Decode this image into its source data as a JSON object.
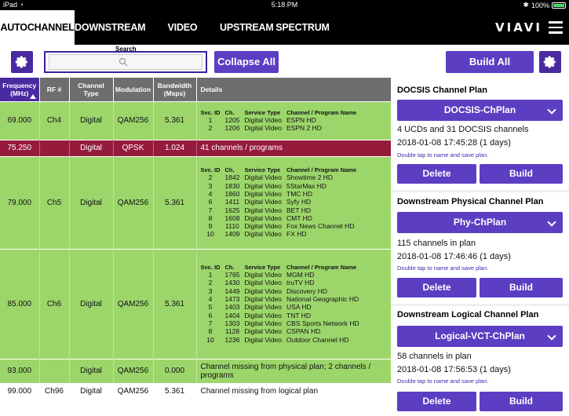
{
  "status_bar": {
    "device": "iPad",
    "time": "5:18 PM",
    "battery": "100%"
  },
  "tabs": [
    "AUTOCHANNEL",
    "DOWNSTREAM",
    "VIDEO ANALYZER",
    "UPSTREAM",
    "SPECTRUM"
  ],
  "brand": "VIAVI",
  "toolbar": {
    "search_label": "Search",
    "search_placeholder": "",
    "collapse_all": "Collapse All",
    "build_all": "Build All"
  },
  "table": {
    "headers": {
      "frequency": "Frequency (MHz)",
      "rf": "RF #",
      "channel_type": "Channel Type",
      "modulation": "Modulation",
      "bandwidth": "Bandwidth (Msps)",
      "details": "Details"
    },
    "svc_headers": {
      "svc_id": "Svc. ID",
      "ch": "Ch.",
      "service_type": "Service Type",
      "program": "Channel / Program Name"
    },
    "rows": [
      {
        "freq": "69.000",
        "rf": "Ch4",
        "type": "Digital",
        "mod": "QAM256",
        "bw": "5.361",
        "services": [
          {
            "id": "1",
            "ch": "1205",
            "stype": "Digital Video",
            "name": "ESPN HD"
          },
          {
            "id": "2",
            "ch": "1206",
            "stype": "Digital Video",
            "name": "ESPN 2 HD"
          }
        ]
      },
      {
        "freq": "75.250",
        "rf": "",
        "type": "Digital",
        "mod": "QPSK",
        "bw": "1.024",
        "note": "41 channels / programs"
      },
      {
        "freq": "79.000",
        "rf": "Ch5",
        "type": "Digital",
        "mod": "QAM256",
        "bw": "5.361",
        "services": [
          {
            "id": "2",
            "ch": "1842",
            "stype": "Digital Video",
            "name": "Showtime 2 HD"
          },
          {
            "id": "3",
            "ch": "1830",
            "stype": "Digital Video",
            "name": "5StarMax HD"
          },
          {
            "id": "4",
            "ch": "1860",
            "stype": "Digital Video",
            "name": "TMC HD"
          },
          {
            "id": "6",
            "ch": "1411",
            "stype": "Digital Video",
            "name": "Syfy HD"
          },
          {
            "id": "7",
            "ch": "1625",
            "stype": "Digital Video",
            "name": "BET HD"
          },
          {
            "id": "8",
            "ch": "1608",
            "stype": "Digital Video",
            "name": "CMT HD"
          },
          {
            "id": "9",
            "ch": "1110",
            "stype": "Digital Video",
            "name": "Fox News Channel HD"
          },
          {
            "id": "10",
            "ch": "1409",
            "stype": "Digital Video",
            "name": "FX HD"
          }
        ]
      },
      {
        "freq": "85.000",
        "rf": "Ch6",
        "type": "Digital",
        "mod": "QAM256",
        "bw": "5.361",
        "services": [
          {
            "id": "1",
            "ch": "1765",
            "stype": "Digital Video",
            "name": "MGM HD"
          },
          {
            "id": "2",
            "ch": "1430",
            "stype": "Digital Video",
            "name": "truTV HD"
          },
          {
            "id": "3",
            "ch": "1449",
            "stype": "Digital Video",
            "name": "Discovery HD"
          },
          {
            "id": "4",
            "ch": "1473",
            "stype": "Digital Video",
            "name": "National Geographic HD"
          },
          {
            "id": "5",
            "ch": "1403",
            "stype": "Digital Video",
            "name": "USA HD"
          },
          {
            "id": "6",
            "ch": "1404",
            "stype": "Digital Video",
            "name": "TNT HD"
          },
          {
            "id": "7",
            "ch": "1303",
            "stype": "Digital Video",
            "name": "CBS Sports Network HD"
          },
          {
            "id": "8",
            "ch": "1128",
            "stype": "Digital Video",
            "name": "CSPAN HD"
          },
          {
            "id": "10",
            "ch": "1236",
            "stype": "Digital Video",
            "name": "Outdoor Channel HD"
          }
        ]
      },
      {
        "freq": "93.000",
        "rf": "",
        "type": "Digital",
        "mod": "QAM256",
        "bw": "0.000",
        "note": "Channel missing from physical plan; 2 channels / programs"
      },
      {
        "freq": "99.000",
        "rf": "Ch96",
        "type": "Digital",
        "mod": "QAM256",
        "bw": "5.361",
        "note": "Channel missing from logical plan"
      }
    ]
  },
  "panel": {
    "docsis": {
      "title": "DOCSIS Channel Plan",
      "plan": "DOCSIS-ChPlan",
      "info1": "4 UCDs and 31 DOCSIS channels",
      "info2": "2018-01-08 17:45:28 (1 days)",
      "hint": "Double tap to name and save plan.",
      "delete": "Delete",
      "build": "Build"
    },
    "physical": {
      "title": "Downstream Physical Channel Plan",
      "plan": "Phy-ChPlan",
      "info1": "115 channels in plan",
      "info2": "2018-01-08 17:46:46 (1 days)",
      "hint": "Double tap to name and save plan.",
      "delete": "Delete",
      "build": "Build"
    },
    "logical": {
      "title": "Downstream Logical Channel Plan",
      "plan": "Logical-VCT-ChPlan",
      "info1": "58 channels in plan",
      "info2": "2018-01-08 17:56:53 (1 days)",
      "hint": "Double tap to name and save plan.",
      "delete": "Delete",
      "build": "Build"
    }
  },
  "colors": {
    "accent": "#5b3ec2",
    "row_ok": "#9cd66b",
    "row_error": "#961a3c"
  }
}
